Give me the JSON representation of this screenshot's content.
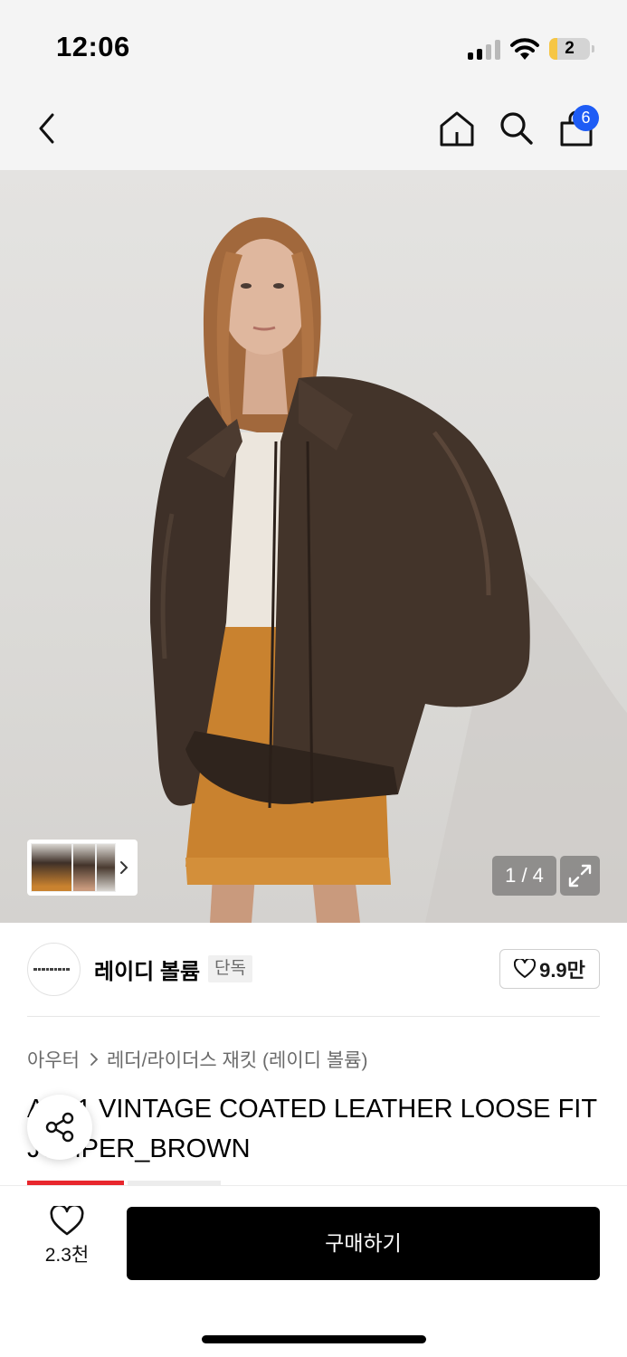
{
  "status_bar": {
    "time": "12:06",
    "battery": "2",
    "battery_level": 0.2
  },
  "nav": {
    "cart_count": "6"
  },
  "gallery": {
    "page_counter": "1 / 4"
  },
  "brand": {
    "name": "레이디 볼륨",
    "tag": "단독",
    "like_count": "9.9만"
  },
  "breadcrumb": {
    "category": "아우터",
    "subcategory": "레더/라이더스 재킷 (레이디 볼륨)"
  },
  "product": {
    "title": "A-1-1 VINTAGE COATED LEATHER LOOSE FIT JUMPER_BROWN"
  },
  "bottom_bar": {
    "wish_count": "2.3천",
    "buy_label": "구매하기"
  },
  "colors": {
    "cart_badge": "#1e5cf5",
    "tab_accent": "#e8262d",
    "buy_button": "#000000"
  }
}
